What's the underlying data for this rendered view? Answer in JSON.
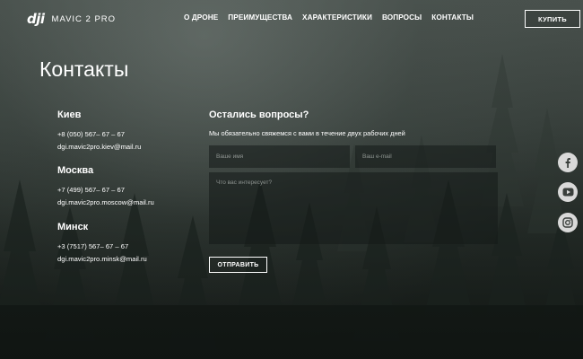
{
  "header": {
    "logo_mark": "dji",
    "logo_model": "MAVIC 2 PRO",
    "nav": [
      "О ДРОНЕ",
      "ПРЕИМУЩЕСТВА",
      "ХАРАКТЕРИСТИКИ",
      "ВОПРОСЫ",
      "КОНТАКТЫ"
    ],
    "buy_label": "КУПИТЬ"
  },
  "page_title": "Контакты",
  "cities": [
    {
      "name": "Киев",
      "phone": "+8 (050) 567– 67 – 67",
      "email": "dgi.mavic2pro.kiev@mail.ru"
    },
    {
      "name": "Москва",
      "phone": "+7 (499) 567– 67 – 67",
      "email": "dgi.mavic2pro.moscow@mail.ru"
    },
    {
      "name": "Минск",
      "phone": "+3 (7517) 567– 67 – 67",
      "email": "dgi.mavic2pro.minsk@mail.ru"
    }
  ],
  "form": {
    "title": "Остались вопросы?",
    "subtitle": "Мы обязательно свяжемся с вами в течение двух рабочих дней",
    "name_placeholder": "Ваше имя",
    "email_placeholder": "Ваш e-mail",
    "message_placeholder": "Что вас интересует?",
    "submit_label": "ОТПРАВИТЬ"
  },
  "social": [
    "facebook-icon",
    "youtube-icon",
    "instagram-icon"
  ]
}
